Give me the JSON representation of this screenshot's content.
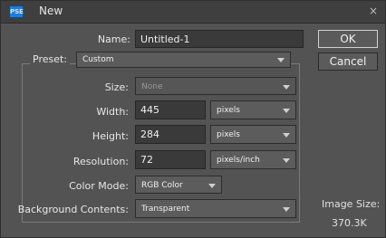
{
  "window": {
    "title": "New",
    "app_icon_text": "PSE",
    "close_glyph": "×"
  },
  "form": {
    "name_label": "Name:",
    "name_value": "Untitled-1",
    "preset_label": "Preset:",
    "preset_value": "Custom",
    "size_label": "Size:",
    "size_value": "None",
    "width_label": "Width:",
    "width_value": "445",
    "width_unit": "pixels",
    "height_label": "Height:",
    "height_value": "284",
    "height_unit": "pixels",
    "resolution_label": "Resolution:",
    "resolution_value": "72",
    "resolution_unit": "pixels/inch",
    "color_mode_label": "Color Mode:",
    "color_mode_value": "RGB Color",
    "background_label": "Background Contents:",
    "background_value": "Transparent"
  },
  "buttons": {
    "ok": "OK",
    "cancel": "Cancel"
  },
  "image_size": {
    "label": "Image Size:",
    "value": "370.3K"
  }
}
